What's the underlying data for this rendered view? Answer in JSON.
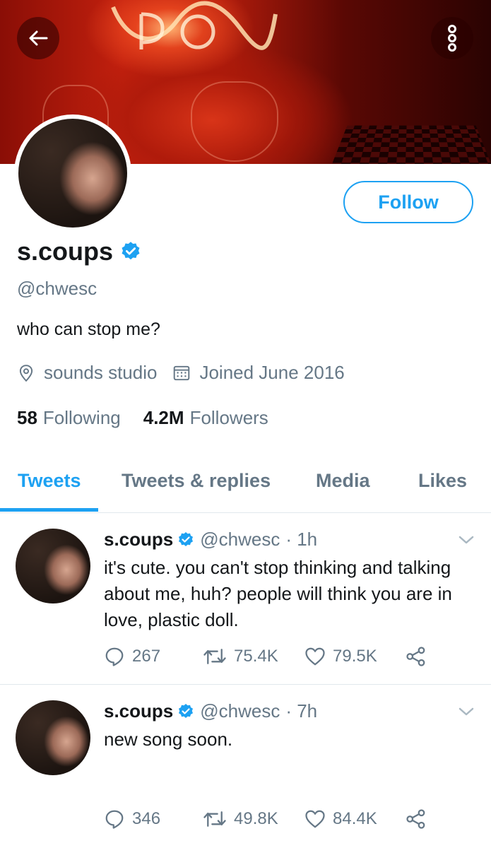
{
  "profile": {
    "name": "s.coups",
    "handle": "@chwesc",
    "bio": "who can stop me?",
    "location": "sounds studio",
    "joined": "Joined June 2016",
    "following_count": "58",
    "following_label": "Following",
    "followers_count": "4.2M",
    "followers_label": "Followers",
    "follow_label": "Follow"
  },
  "tabs": [
    "Tweets",
    "Tweets & replies",
    "Media",
    "Likes"
  ],
  "tweets": [
    {
      "name": "s.coups",
      "handle": "@chwesc",
      "time": "· 1h",
      "text": "it's cute. you can't stop thinking and talking about me, huh? people will think you are in love, plastic doll.",
      "replies": "267",
      "retweets": "75.4K",
      "likes": "79.5K"
    },
    {
      "name": "s.coups",
      "handle": "@chwesc",
      "time": "· 7h",
      "text": "new song soon.",
      "replies": "346",
      "retweets": "49.8K",
      "likes": "84.4K"
    }
  ],
  "colors": {
    "accent": "#1da1f2",
    "secondary_text": "#657786",
    "primary_text": "#14171a"
  },
  "icons": [
    "back-arrow-icon",
    "more-vertical-icon",
    "verified-badge-icon",
    "location-icon",
    "calendar-icon",
    "reply-icon",
    "retweet-icon",
    "like-icon",
    "share-icon",
    "chevron-down-icon"
  ]
}
